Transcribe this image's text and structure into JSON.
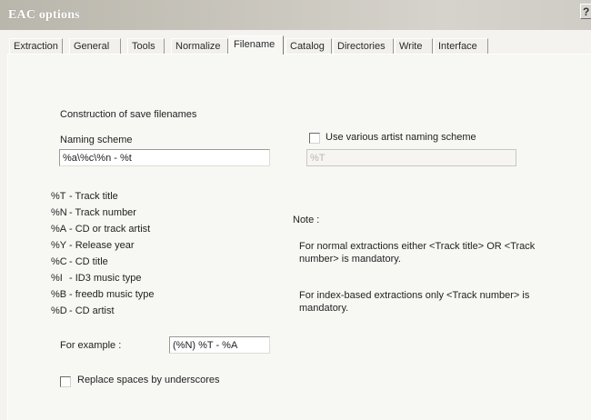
{
  "window": {
    "title": "EAC options",
    "help_glyph": "?"
  },
  "tabs": [
    {
      "label": "Extraction"
    },
    {
      "label": "General"
    },
    {
      "label": "Tools"
    },
    {
      "label": "Normalize"
    },
    {
      "label": "Filename",
      "active": true
    },
    {
      "label": "Catalog"
    },
    {
      "label": "Directories"
    },
    {
      "label": "Write"
    },
    {
      "label": "Interface"
    }
  ],
  "filename": {
    "section_title": "Construction of save filenames",
    "naming_scheme_label": "Naming scheme",
    "naming_scheme_value": "%a\\%c\\%n - %t",
    "various_artist_checkbox_label": "Use various artist naming scheme",
    "various_artist_checked": false,
    "various_artist_value": "%T",
    "legend": [
      {
        "code": "%T",
        "desc": "- Track title"
      },
      {
        "code": "%N",
        "desc": "- Track number"
      },
      {
        "code": "%A",
        "desc": "- CD or track artist"
      },
      {
        "code": "%Y",
        "desc": "- Release year"
      },
      {
        "code": "%C",
        "desc": "- CD title"
      },
      {
        "code": "%I",
        "desc": "- ID3 music type"
      },
      {
        "code": "%B",
        "desc": "- freedb music type"
      },
      {
        "code": "%D",
        "desc": "- CD artist"
      }
    ],
    "example_label": "For example :",
    "example_value": "(%N) %T - %A",
    "replace_spaces_label": "Replace spaces by underscores",
    "replace_spaces_checked": false,
    "note_title": "Note :",
    "note_1": "For normal extractions either <Track title>  OR  <Track number> is mandatory.",
    "note_2": "For index-based extractions only <Track number> is mandatory."
  }
}
